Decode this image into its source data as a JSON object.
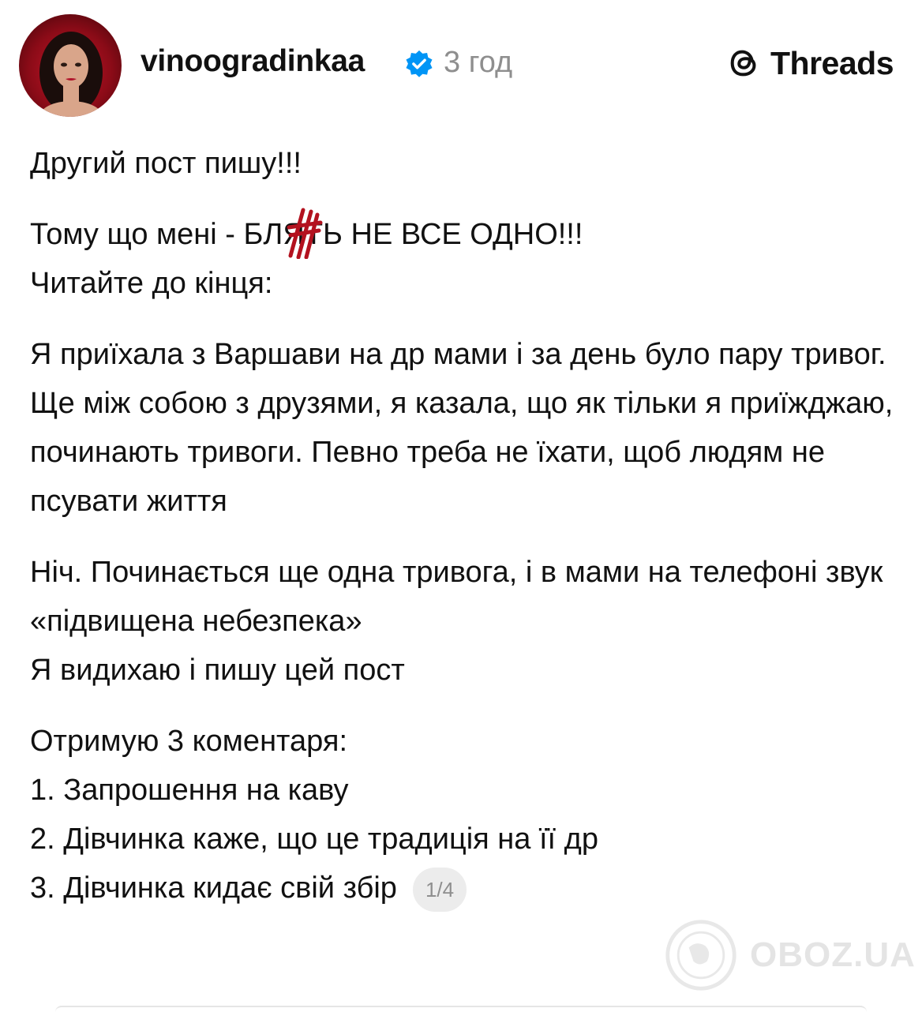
{
  "header": {
    "username": "vinoogradinkaa",
    "timestamp": "3 год",
    "brand": "Threads",
    "verified_color": "#0095f6"
  },
  "post": {
    "p1": "Другий пост пишу!!!",
    "p2_before": "Тому що мені - БЛ",
    "p2_censored": "Я",
    "p2_after": "ТЬ НЕ ВСЕ ОДНО!!!",
    "p3": "Читайте до кінця:",
    "p4": "Я приїхала з Варшави на др мами і за день було пару тривог. Ще між собою з друзями, я казала, що як тільки я приїжджаю, починають тривоги. Певно треба не їхати, щоб людям не псувати життя",
    "p5": "Ніч. Починається ще одна тривога, і в мами на телефоні звук «підвищена небезпека»",
    "p6": "Я видихаю і пишу цей пост",
    "p7": "Отримую 3 коментаря:",
    "item1": "1. Запрошення на каву",
    "item2": "2. Дівчинка каже, що це традиція на її др",
    "item3": "3. Дівчинка кидає свій збір",
    "pager": "1/4",
    "censor_color": "#b3121f"
  },
  "watermark": {
    "text": "OBOZ.UA"
  }
}
